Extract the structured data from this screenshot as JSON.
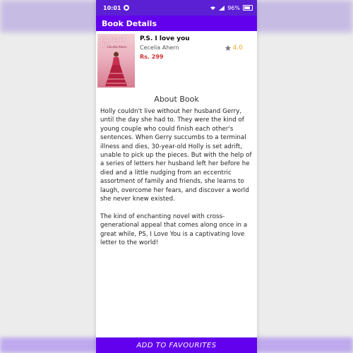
{
  "status_bar": {
    "time": "10:01",
    "battery": "96%"
  },
  "app_bar": {
    "title": "Book Details"
  },
  "book": {
    "title": "P.S. I love you",
    "author": "Cecelia Ahern",
    "price": "Rs. 299",
    "rating": "4.0",
    "cover_title": "PS, I Love You",
    "cover_author": "Cecelia Ahern"
  },
  "about": {
    "heading": "About Book",
    "description": "Holly couldn't live without her husband Gerry, until the day she had to. They were the kind of young couple who could finish each other's sentences. When Gerry succumbs to a terminal illness and dies, 30-year-old Holly is set adrift, unable to pick up the pieces. But with the help of a series of letters her husband left her before he died and a little nudging from an eccentric assortment of family and friends, she learns to laugh, overcome her fears, and discover a world she never knew existed.\n\nThe kind of enchanting novel with cross-generational appeal that comes along once in a great while, PS, I Love You is a captivating love letter to the world!"
  },
  "actions": {
    "add_to_favourites": "ADD TO FAVOURITES"
  },
  "colors": {
    "primary": "#6200ee",
    "status_bar": "#5b1fd4",
    "price": "#d32f2f",
    "star_filled": "#7a7a7a",
    "rating_text": "#f5a623"
  }
}
